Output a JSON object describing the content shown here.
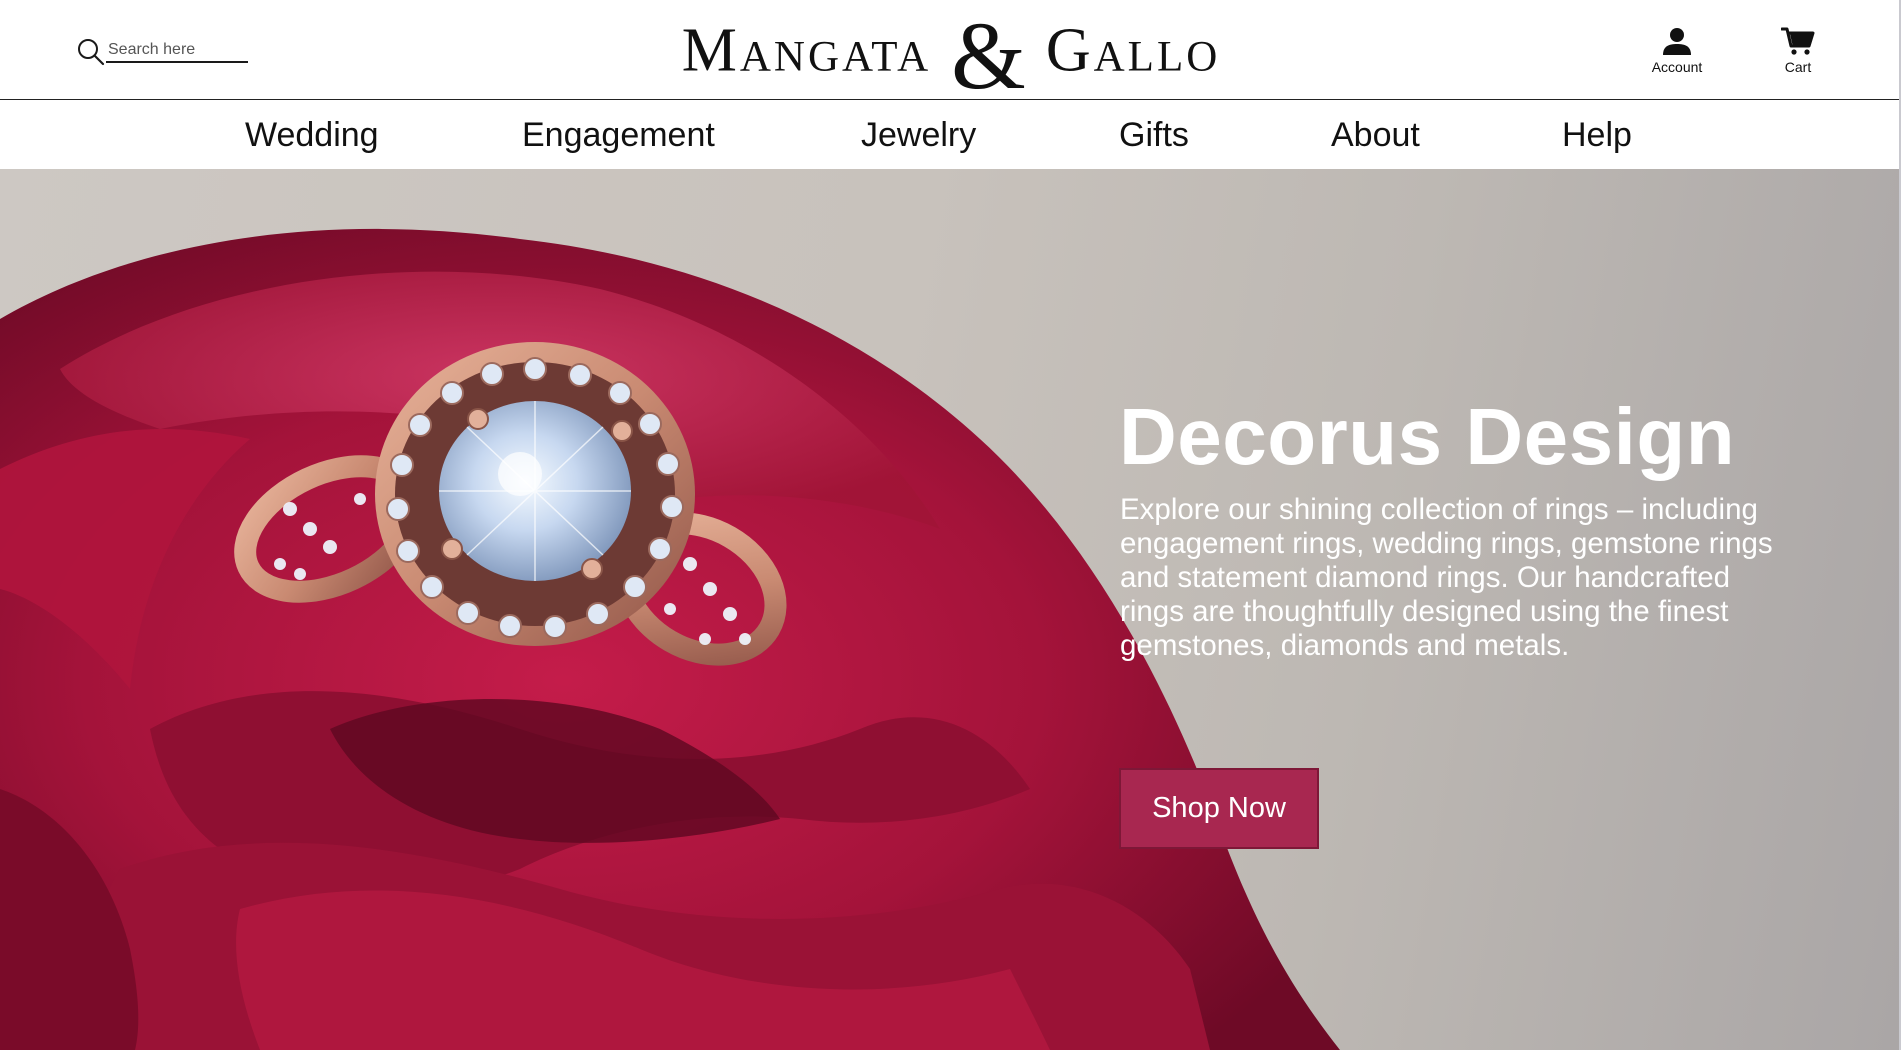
{
  "header": {
    "search_placeholder": "Search here",
    "logo_left": "Mangata",
    "logo_amp": "&",
    "logo_right": "Gallo",
    "account_label": "Account",
    "cart_label": "Cart"
  },
  "nav": {
    "items": [
      {
        "label": "Wedding"
      },
      {
        "label": "Engagement"
      },
      {
        "label": "Jewelry"
      },
      {
        "label": "Gifts"
      },
      {
        "label": "About"
      },
      {
        "label": "Help"
      }
    ]
  },
  "hero": {
    "title": "Decorus Design",
    "description": "Explore our shining collection of rings – including engagement rings, wedding rings, gemstone rings and statement diamond rings. Our handcrafted rings are thoughtfully designed using the finest gemstones, diamonds and metals.",
    "button_label": "Shop Now",
    "image": "rose-gold diamond halo ring resting in a red rose"
  },
  "colors": {
    "button_bg": "#a82750",
    "header_bg": "#ffffff",
    "text_dark": "#111111",
    "hero_text": "#ffffff",
    "rose": "#b3173f"
  },
  "icons": {
    "search": "search-icon",
    "account": "account-icon",
    "cart": "cart-icon"
  }
}
